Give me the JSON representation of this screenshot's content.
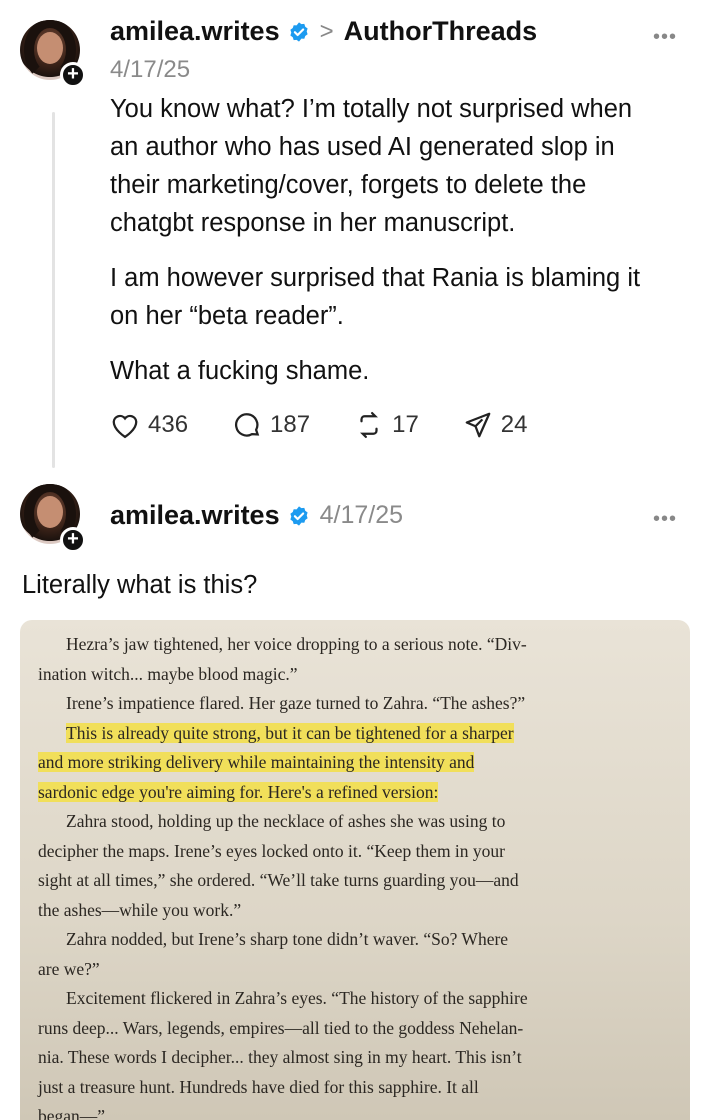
{
  "post1": {
    "handle": "amilea.writes",
    "separator": ">",
    "community": "AuthorThreads",
    "date": "4/17/25",
    "more": "•••",
    "paragraphs": [
      [
        "You know what? I’m totally not surprised when",
        "an author who has used AI generated slop in",
        "their marketing/cover, forgets to delete the",
        "chatgbt response in her manuscript."
      ],
      [
        "I am however surprised that Rania is blaming it",
        "on her “beta reader”."
      ],
      [
        "What a fucking shame."
      ]
    ],
    "metrics": {
      "likes": "436",
      "replies": "187",
      "reposts": "17",
      "shares": "24"
    }
  },
  "post2": {
    "handle": "amilea.writes",
    "date": "4/17/25",
    "more": "•••",
    "text": "Literally what is this?"
  },
  "book_page": {
    "lines": [
      {
        "text": "Hezra’s jaw tightened, her voice dropping to a serious note. “Div-",
        "indent": true,
        "highlight": false
      },
      {
        "text": "ination witch... maybe blood magic.”",
        "indent": false,
        "highlight": false
      },
      {
        "text": "Irene’s impatience flared. Her gaze turned to Zahra. “The ashes?”",
        "indent": true,
        "highlight": false
      },
      {
        "text": "This is already quite strong, but it can be tightened for a sharper",
        "indent": true,
        "highlight": true
      },
      {
        "text": "and more striking delivery while maintaining the intensity and",
        "indent": false,
        "highlight": true
      },
      {
        "text": "sardonic edge you're aiming for. Here's a refined version:",
        "indent": false,
        "highlight": true
      },
      {
        "text": "Zahra stood, holding up the necklace of ashes she was using to",
        "indent": true,
        "highlight": false
      },
      {
        "text": "decipher the maps. Irene’s eyes locked onto it. “Keep them in your",
        "indent": false,
        "highlight": false
      },
      {
        "text": "sight at all times,” she ordered. “We’ll take turns guarding you—and",
        "indent": false,
        "highlight": false
      },
      {
        "text": "the ashes—while you work.”",
        "indent": false,
        "highlight": false
      },
      {
        "text": "Zahra nodded, but Irene’s sharp tone didn’t waver. “So? Where",
        "indent": true,
        "highlight": false
      },
      {
        "text": "are we?”",
        "indent": false,
        "highlight": false
      },
      {
        "text": "Excitement flickered in Zahra’s eyes. “The history of the sapphire",
        "indent": true,
        "highlight": false
      },
      {
        "text": "runs deep... Wars, legends, empires—all tied to the goddess Nehelan-",
        "indent": false,
        "highlight": false
      },
      {
        "text": "nia. These words I decipher... they almost sing in my heart. This isn’t",
        "indent": false,
        "highlight": false
      },
      {
        "text": "just a treasure hunt. Hundreds have died for this sapphire. It all",
        "indent": false,
        "highlight": false
      },
      {
        "text": "began—”",
        "indent": false,
        "highlight": false
      }
    ]
  },
  "colors": {
    "verified": "#1d9bf0",
    "highlight": "#f1df5a",
    "thread_line": "#e3e3e3"
  }
}
